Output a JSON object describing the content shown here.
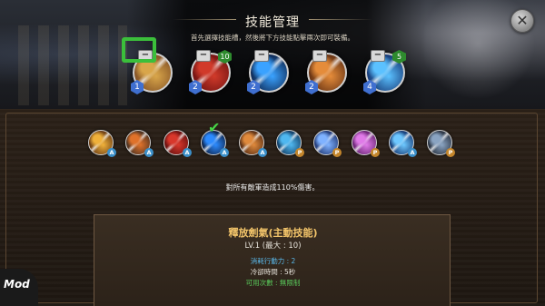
{
  "header": {
    "title": "技能管理",
    "subtitle": "首先選擇技能槽，然後將下方技能點擊兩次即可裝備。"
  },
  "equipped_slots": [
    {
      "name": "slot-1",
      "cost": "1",
      "count": "",
      "remove": "−",
      "selected": true,
      "colors": [
        "#7d4b22",
        "#d9a64a"
      ]
    },
    {
      "name": "slot-2",
      "cost": "2",
      "count": "10",
      "remove": "−",
      "selected": false,
      "colors": [
        "#6a1010",
        "#d13a2a"
      ]
    },
    {
      "name": "slot-3",
      "cost": "2",
      "count": "",
      "remove": "−",
      "selected": false,
      "colors": [
        "#0a1e45",
        "#3aa2ff"
      ]
    },
    {
      "name": "slot-4",
      "cost": "2",
      "count": "",
      "remove": "−",
      "selected": false,
      "colors": [
        "#5a2a10",
        "#e58c3a"
      ]
    },
    {
      "name": "slot-5",
      "cost": "4",
      "count": "5",
      "remove": "−",
      "selected": false,
      "colors": [
        "#0f2c6a",
        "#5bc1ff"
      ]
    }
  ],
  "skills": [
    {
      "name": "skill-1",
      "type": "A",
      "equipped": false,
      "colors": [
        "#5b2f10",
        "#f0b13a"
      ]
    },
    {
      "name": "skill-2",
      "type": "A",
      "equipped": false,
      "colors": [
        "#3a2a20",
        "#e0722a"
      ]
    },
    {
      "name": "skill-3",
      "type": "A",
      "equipped": false,
      "colors": [
        "#5a0c0c",
        "#d8372b"
      ]
    },
    {
      "name": "skill-4",
      "type": "A",
      "equipped": true,
      "colors": [
        "#0a1836",
        "#2c8bff"
      ]
    },
    {
      "name": "skill-5",
      "type": "A",
      "equipped": false,
      "colors": [
        "#4a2410",
        "#e08a3c"
      ]
    },
    {
      "name": "skill-6",
      "type": "P",
      "equipped": false,
      "colors": [
        "#0b2f55",
        "#4fb8f0"
      ]
    },
    {
      "name": "skill-7",
      "type": "P",
      "equipped": false,
      "colors": [
        "#152a66",
        "#7fb2ff"
      ]
    },
    {
      "name": "skill-8",
      "type": "P",
      "equipped": false,
      "colors": [
        "#5b1a66",
        "#e07ae8"
      ]
    },
    {
      "name": "skill-9",
      "type": "A",
      "equipped": false,
      "colors": [
        "#0a2a66",
        "#6ec8ff"
      ]
    },
    {
      "name": "skill-10",
      "type": "P",
      "equipped": false,
      "colors": [
        "#1d2430",
        "#8aa4c2"
      ]
    }
  ],
  "effect_text": "對所有敵軍造成110%傷害。",
  "detail": {
    "name": "釋放劍氣(主動技能)",
    "level": "LV.1 (最大 : 10)",
    "cost": "消耗行動力 : 2",
    "cooldown": "冷卻時間 : 5秒",
    "uses": "可用次數 : 無限制"
  },
  "close_glyph": "✕",
  "watermark": "Mod"
}
